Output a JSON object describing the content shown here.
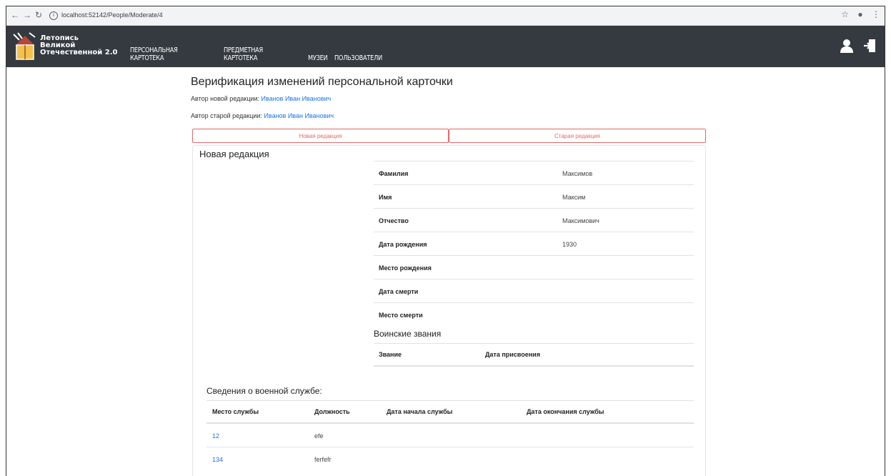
{
  "browser": {
    "url": "localhost:52142/People/Moderate/4"
  },
  "navbar": {
    "logo_lines": [
      "Летопись",
      "Великой",
      "Отечественной 2.0"
    ],
    "menu": [
      "ПЕРСОНАЛЬНАЯ КАРТОТЕКА",
      "ПРЕДМЕТНАЯ КАРТОТЕКА",
      "МУЗЕИ",
      "ПОЛЬЗОВАТЕЛИ"
    ]
  },
  "page": {
    "title": "Верификация изменений персональной карточки",
    "new_author_label": "Автор новой редакции:",
    "new_author_name": "Иванов Иван Иванович",
    "old_author_label": "Автор старой редакции:",
    "old_author_name": "Иванов Иван Иванович"
  },
  "tabs": [
    "Новая редакция",
    "Старая редакция"
  ],
  "card": {
    "title": "Новая редакция",
    "fields": [
      {
        "label": "Фамилия",
        "value": "Максимов"
      },
      {
        "label": "Имя",
        "value": "Максим"
      },
      {
        "label": "Отчество",
        "value": "Максимович"
      },
      {
        "label": "Дата рождения",
        "value": "1930"
      },
      {
        "label": "Место рождения",
        "value": ""
      },
      {
        "label": "Дата смерти",
        "value": ""
      },
      {
        "label": "Место смерти",
        "value": ""
      }
    ],
    "ranks_title": "Воинские звания",
    "ranks_headers": [
      "Звание",
      "Дата присвоения"
    ],
    "service_title": "Сведения о военной службе:",
    "service_headers": [
      "Место службы",
      "Должность",
      "Дата начала службы",
      "Дата окончания службы"
    ],
    "service_rows": [
      {
        "place": "12",
        "position": "efe"
      },
      {
        "place": "134",
        "position": "ferfefr"
      }
    ]
  },
  "colors": {
    "navbar": "#343a40",
    "link": "#1a73e8",
    "tab_accent": "#e06a6a"
  }
}
